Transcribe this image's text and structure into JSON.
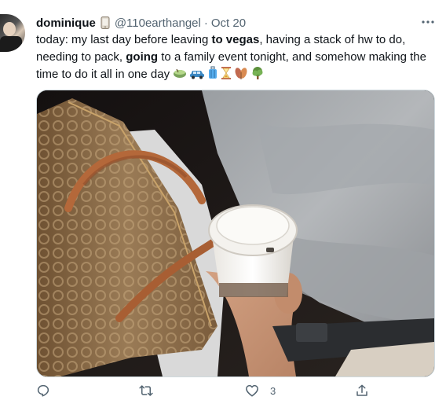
{
  "tweet": {
    "author_name": "dominique",
    "handle": "@110earthangel",
    "separator": "·",
    "date": "Oct 20",
    "text_parts": [
      {
        "text": "today: my last day before leaving ",
        "bold": false
      },
      {
        "text": "to vegas",
        "bold": true
      },
      {
        "text": ", having a stack of hw to do, needing to pack, ",
        "bold": false
      },
      {
        "text": "going",
        "bold": true
      },
      {
        "text": " to a family event tonight, and somehow making the time to do it all in one day",
        "bold": false
      }
    ],
    "emojis": [
      "matcha-icon",
      "car-icon",
      "suitcase-icon",
      "hourglass-icon",
      "leaves-icon",
      "tree-icon"
    ],
    "media_alt_description_icon": "photo-coffee-cup-bag"
  },
  "actions": {
    "reply_count": "",
    "retweet_count": "",
    "like_count": "3",
    "share_count": ""
  },
  "colors": {
    "text": "#0f1419",
    "muted": "#536471",
    "border": "#cfd9de"
  }
}
